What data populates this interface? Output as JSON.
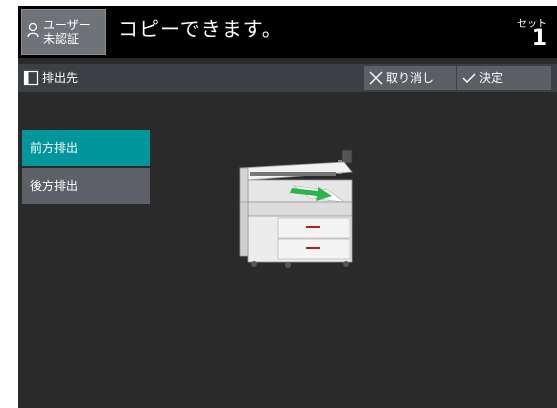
{
  "header": {
    "user_line1": "ユーザー",
    "user_line2": "未認証",
    "status_message": "コピーできます。",
    "set_label": "セット",
    "set_count": "1"
  },
  "titlebar": {
    "title": "排出先",
    "cancel_label": "取り消し",
    "ok_label": "決定"
  },
  "options": [
    {
      "label": "前方排出",
      "selected": true
    },
    {
      "label": "後方排出",
      "selected": false
    }
  ],
  "colors": {
    "selected": "#00969b",
    "unselected": "#5d6167",
    "background": "#2a2a2a"
  },
  "icons": [
    "user-icon",
    "output-tray-icon",
    "close-x-icon",
    "checkmark-icon",
    "printer-illustration"
  ]
}
